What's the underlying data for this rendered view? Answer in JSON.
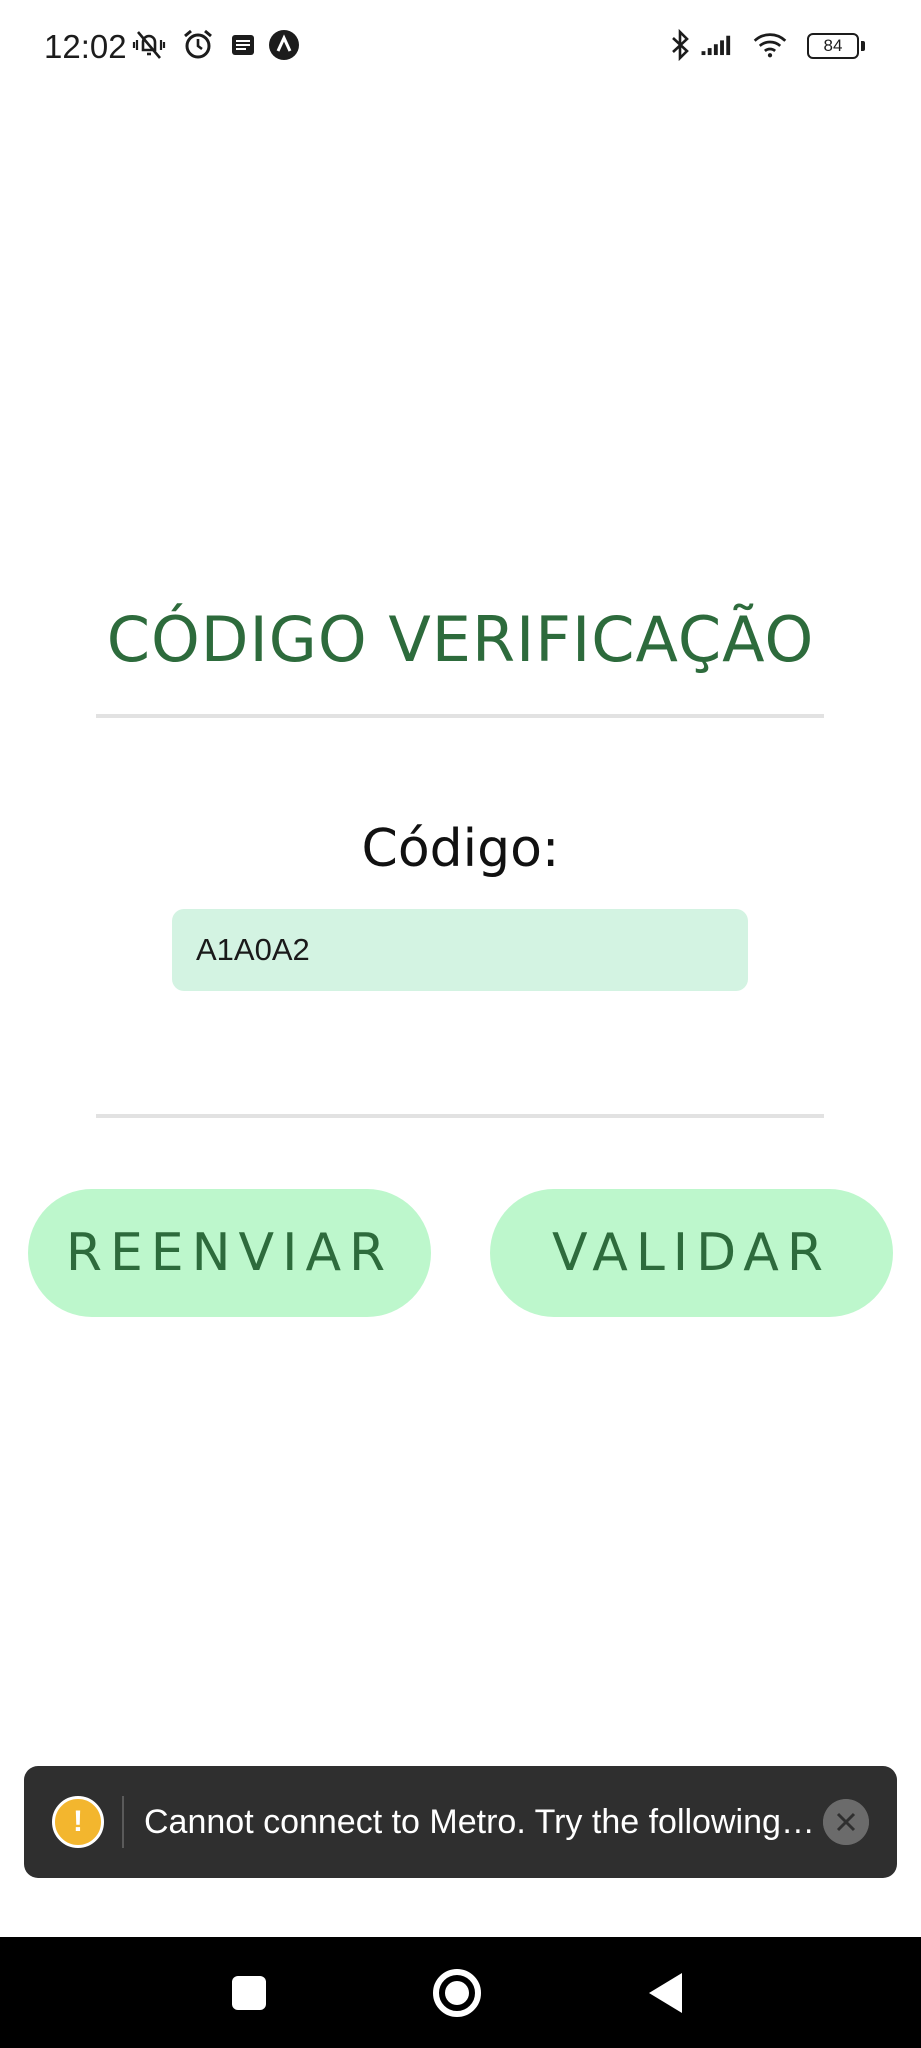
{
  "status_bar": {
    "time": "12:02",
    "battery": "84",
    "icons": [
      "vibrate-mute-icon",
      "alarm-icon",
      "notes-icon",
      "app-launcher-icon",
      "bluetooth-icon",
      "signal-icon",
      "wifi-icon",
      "battery-icon"
    ]
  },
  "screen": {
    "title": "CÓDIGO VERIFICAÇÃO",
    "code_label": "Código:",
    "code_value": "A1A0A2"
  },
  "buttons": {
    "resend": "REENVIAR",
    "validate": "VALIDAR"
  },
  "toast": {
    "message": "Cannot connect to Metro.  Try the following…",
    "warning_glyph": "!"
  },
  "nav_bar": {
    "items": [
      "recents-button",
      "home-button",
      "back-button"
    ]
  },
  "colors": {
    "accent_green": "#2d6b3c",
    "button_bg": "#bdf7cc",
    "input_bg": "#d3f3e2",
    "toast_bg": "#2f2f2f",
    "warning": "#f3b62e"
  }
}
